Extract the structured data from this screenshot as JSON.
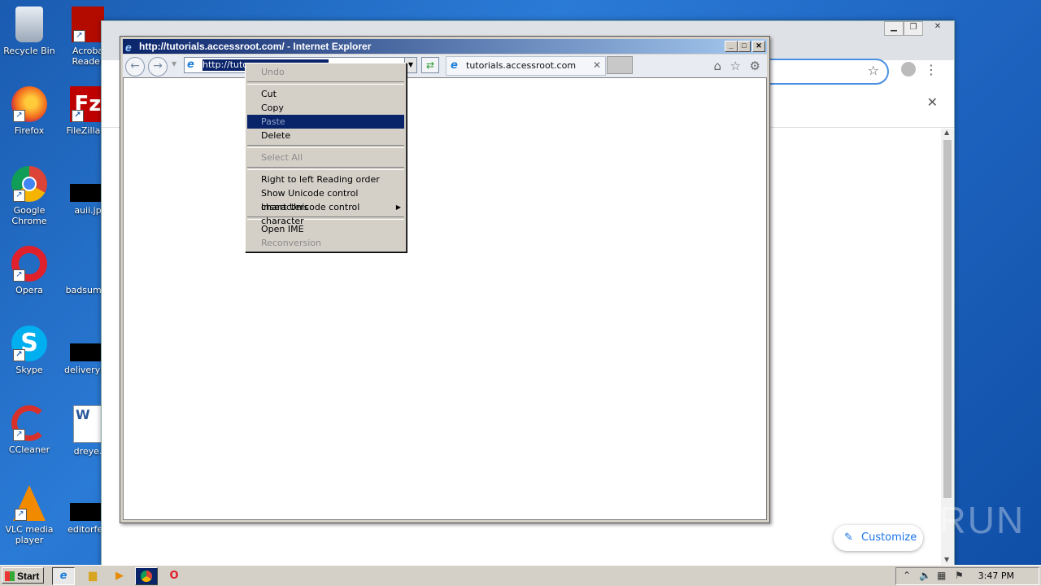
{
  "desktop": {
    "icons_left": [
      {
        "label": "Recycle Bin",
        "name": "recycle-bin-icon"
      },
      {
        "label": "Firefox",
        "name": "firefox-icon"
      },
      {
        "label": "Google Chrome",
        "name": "chrome-icon"
      },
      {
        "label": "Opera",
        "name": "opera-icon"
      },
      {
        "label": "Skype",
        "name": "skype-icon"
      },
      {
        "label": "CCleaner",
        "name": "ccleaner-icon"
      },
      {
        "label": "VLC media player",
        "name": "vlc-icon"
      }
    ],
    "icons_col2": [
      {
        "label": "Acroba Reader",
        "name": "acrobat-reader-icon"
      },
      {
        "label": "FileZilla C",
        "name": "filezilla-icon"
      },
      {
        "label": "auii.jp",
        "name": "file-icon"
      },
      {
        "label": "badsumm",
        "name": "file-icon"
      },
      {
        "label": "deliveryap",
        "name": "file-icon"
      },
      {
        "label": "dreye.",
        "name": "word-doc-icon"
      },
      {
        "label": "editorfee",
        "name": "file-icon"
      }
    ]
  },
  "ie": {
    "title": "http://tutorials.accessroot.com/ - Internet Explorer",
    "address_selected": "http://tuto",
    "tab_label": "tutorials.accessroot.com"
  },
  "context_menu": {
    "groups": [
      [
        {
          "label": "Undo",
          "enabled": false
        }
      ],
      [
        {
          "label": "Cut",
          "enabled": true
        },
        {
          "label": "Copy",
          "enabled": true
        },
        {
          "label": "Paste",
          "enabled": false,
          "highlighted": true
        },
        {
          "label": "Delete",
          "enabled": true
        }
      ],
      [
        {
          "label": "Select All",
          "enabled": false
        }
      ],
      [
        {
          "label": "Right to left Reading order",
          "enabled": true
        },
        {
          "label": "Show Unicode control characters",
          "enabled": true
        },
        {
          "label": "Insert Unicode control character",
          "enabled": true,
          "submenu": true
        }
      ],
      [
        {
          "label": "Open IME",
          "enabled": true
        },
        {
          "label": "Reconversion",
          "enabled": false
        }
      ]
    ]
  },
  "chrome": {
    "customize_label": "Customize"
  },
  "taskbar": {
    "start_label": "Start",
    "clock": "3:47 PM"
  },
  "watermark": "ANY RUN"
}
